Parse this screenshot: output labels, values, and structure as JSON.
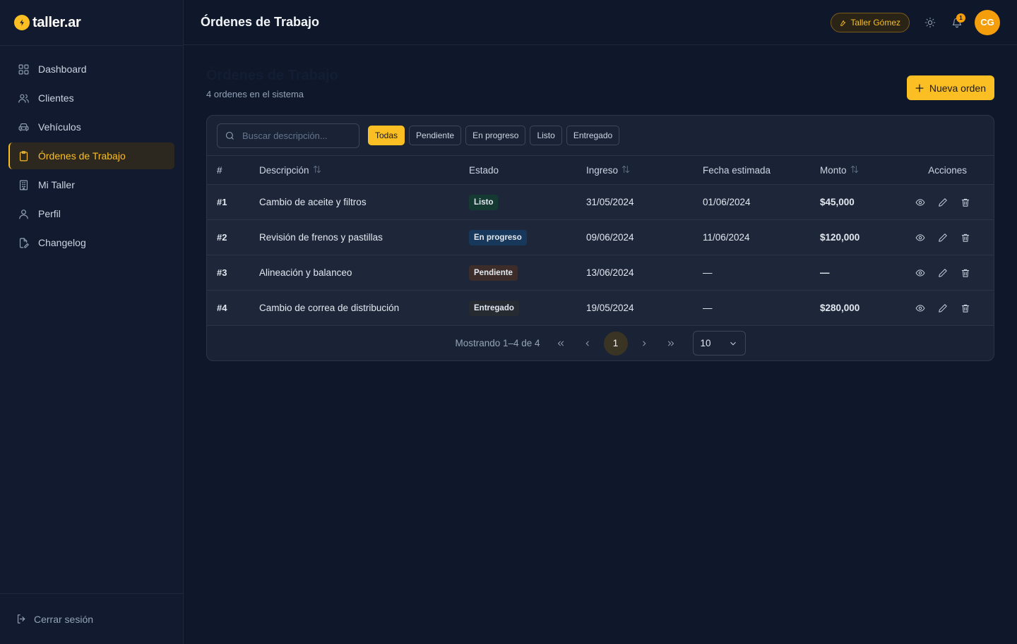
{
  "brand": {
    "name": "taller.ar",
    "accent": "#fbbf24"
  },
  "sidebar": {
    "items": [
      {
        "label": "Dashboard",
        "icon": "grid-icon"
      },
      {
        "label": "Clientes",
        "icon": "users-icon"
      },
      {
        "label": "Vehículos",
        "icon": "car-icon"
      },
      {
        "label": "Órdenes de Trabajo",
        "icon": "clipboard-icon",
        "active": true
      },
      {
        "label": "Mi Taller",
        "icon": "building-icon"
      },
      {
        "label": "Perfil",
        "icon": "user-icon"
      },
      {
        "label": "Changelog",
        "icon": "file-edit-icon"
      }
    ],
    "logout_label": "Cerrar sesión"
  },
  "header": {
    "title": "Órdenes de Trabajo",
    "shop_label": "Taller Gómez",
    "notification_count": "1",
    "avatar_initials": "CG"
  },
  "page": {
    "title": "Órdenes de Trabajo",
    "subtitle": "4 ordenes en el sistema",
    "new_button_label": "Nueva orden"
  },
  "filters": {
    "search_placeholder": "Buscar descripción...",
    "chips": [
      {
        "label": "Todas",
        "active": true
      },
      {
        "label": "Pendiente"
      },
      {
        "label": "En progreso"
      },
      {
        "label": "Listo"
      },
      {
        "label": "Entregado"
      }
    ]
  },
  "table": {
    "columns": {
      "num": "#",
      "desc": "Descripción",
      "status": "Estado",
      "ingreso": "Ingreso",
      "estimada": "Fecha estimada",
      "monto": "Monto",
      "acciones": "Acciones"
    },
    "rows": [
      {
        "num": "#1",
        "desc": "Cambio de aceite y filtros",
        "status": "Listo",
        "status_bg": "#153a32",
        "status_fg": "#e2e8f0",
        "ingreso": "31/05/2024",
        "estimada": "01/06/2024",
        "monto": "$45,000"
      },
      {
        "num": "#2",
        "desc": "Revisión de frenos y pastillas",
        "status": "En progreso",
        "status_bg": "#17385a",
        "status_fg": "#e2e8f0",
        "ingreso": "09/06/2024",
        "estimada": "11/06/2024",
        "monto": "$120,000"
      },
      {
        "num": "#3",
        "desc": "Alineación y balanceo",
        "status": "Pendiente",
        "status_bg": "#3d2d2a",
        "status_fg": "#e2e8f0",
        "ingreso": "13/06/2024",
        "estimada": "—",
        "monto": "—"
      },
      {
        "num": "#4",
        "desc": "Cambio de correa de distribución",
        "status": "Entregado",
        "status_bg": "#262a31",
        "status_fg": "#e2e8f0",
        "ingreso": "19/05/2024",
        "estimada": "—",
        "monto": "$280,000"
      }
    ]
  },
  "pagination": {
    "summary": "Mostrando 1–4 de 4",
    "current_page": "1",
    "page_size": "10"
  }
}
